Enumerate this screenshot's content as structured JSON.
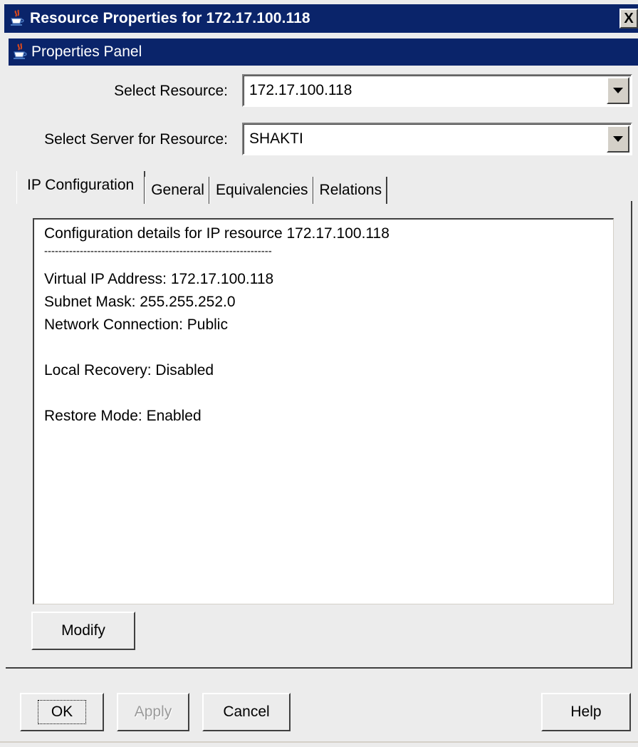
{
  "window": {
    "title": "Resource Properties for 172.17.100.118",
    "title_icon": "java-cup-icon",
    "close_label": "X"
  },
  "panel": {
    "header": "Properties Panel",
    "header_icon": "java-cup-icon"
  },
  "form": {
    "select_resource_label": "Select Resource:",
    "select_resource_value": "172.17.100.118",
    "select_server_label": "Select Server for Resource:",
    "select_server_value": "SHAKTI"
  },
  "tabs": [
    {
      "label": "IP Configuration",
      "active": true
    },
    {
      "label": "General",
      "active": false
    },
    {
      "label": "Equivalencies",
      "active": false
    },
    {
      "label": "Relations",
      "active": false
    }
  ],
  "details": {
    "lines": [
      "Configuration details for IP resource 172.17.100.118",
      "----------------------------------------------------------------",
      "Virtual IP Address: 172.17.100.118",
      "Subnet Mask: 255.255.252.0",
      "Network Connection: Public",
      "",
      "Local Recovery: Disabled",
      "",
      "Restore Mode: Enabled"
    ]
  },
  "buttons": {
    "modify": "Modify",
    "ok": "OK",
    "apply": "Apply",
    "cancel": "Cancel",
    "help": "Help"
  },
  "colors": {
    "titlebar": "#0a246a",
    "background": "#ececec",
    "disabled_text": "#9a9a9a"
  }
}
